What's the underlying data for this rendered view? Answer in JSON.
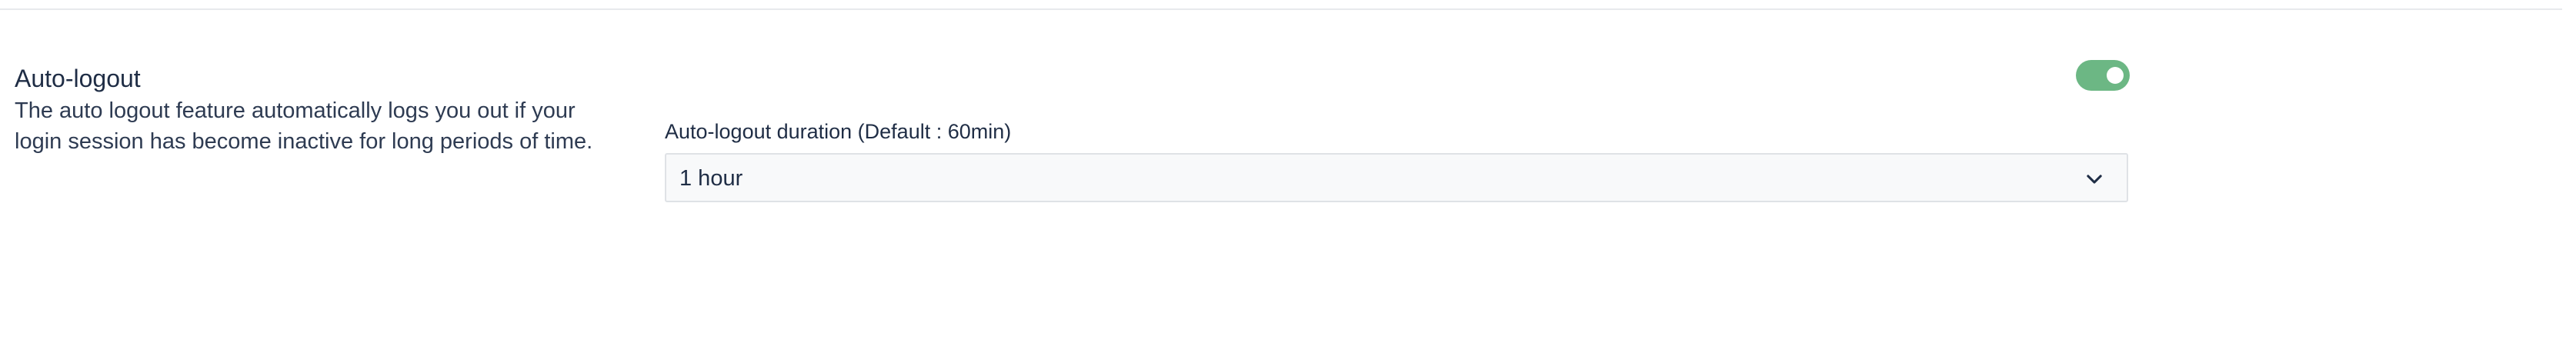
{
  "auto_logout": {
    "title": "Auto-logout",
    "description_line1": "The auto logout feature automatically logs you out if your",
    "description_line2": "login session has become inactive for long periods of time.",
    "enabled": true,
    "toggle_color": "#6cb784",
    "duration_label": "Auto-logout duration (Default : 60min)",
    "duration_value": "1 hour",
    "dropdown_icon": "chevron-down-icon"
  }
}
